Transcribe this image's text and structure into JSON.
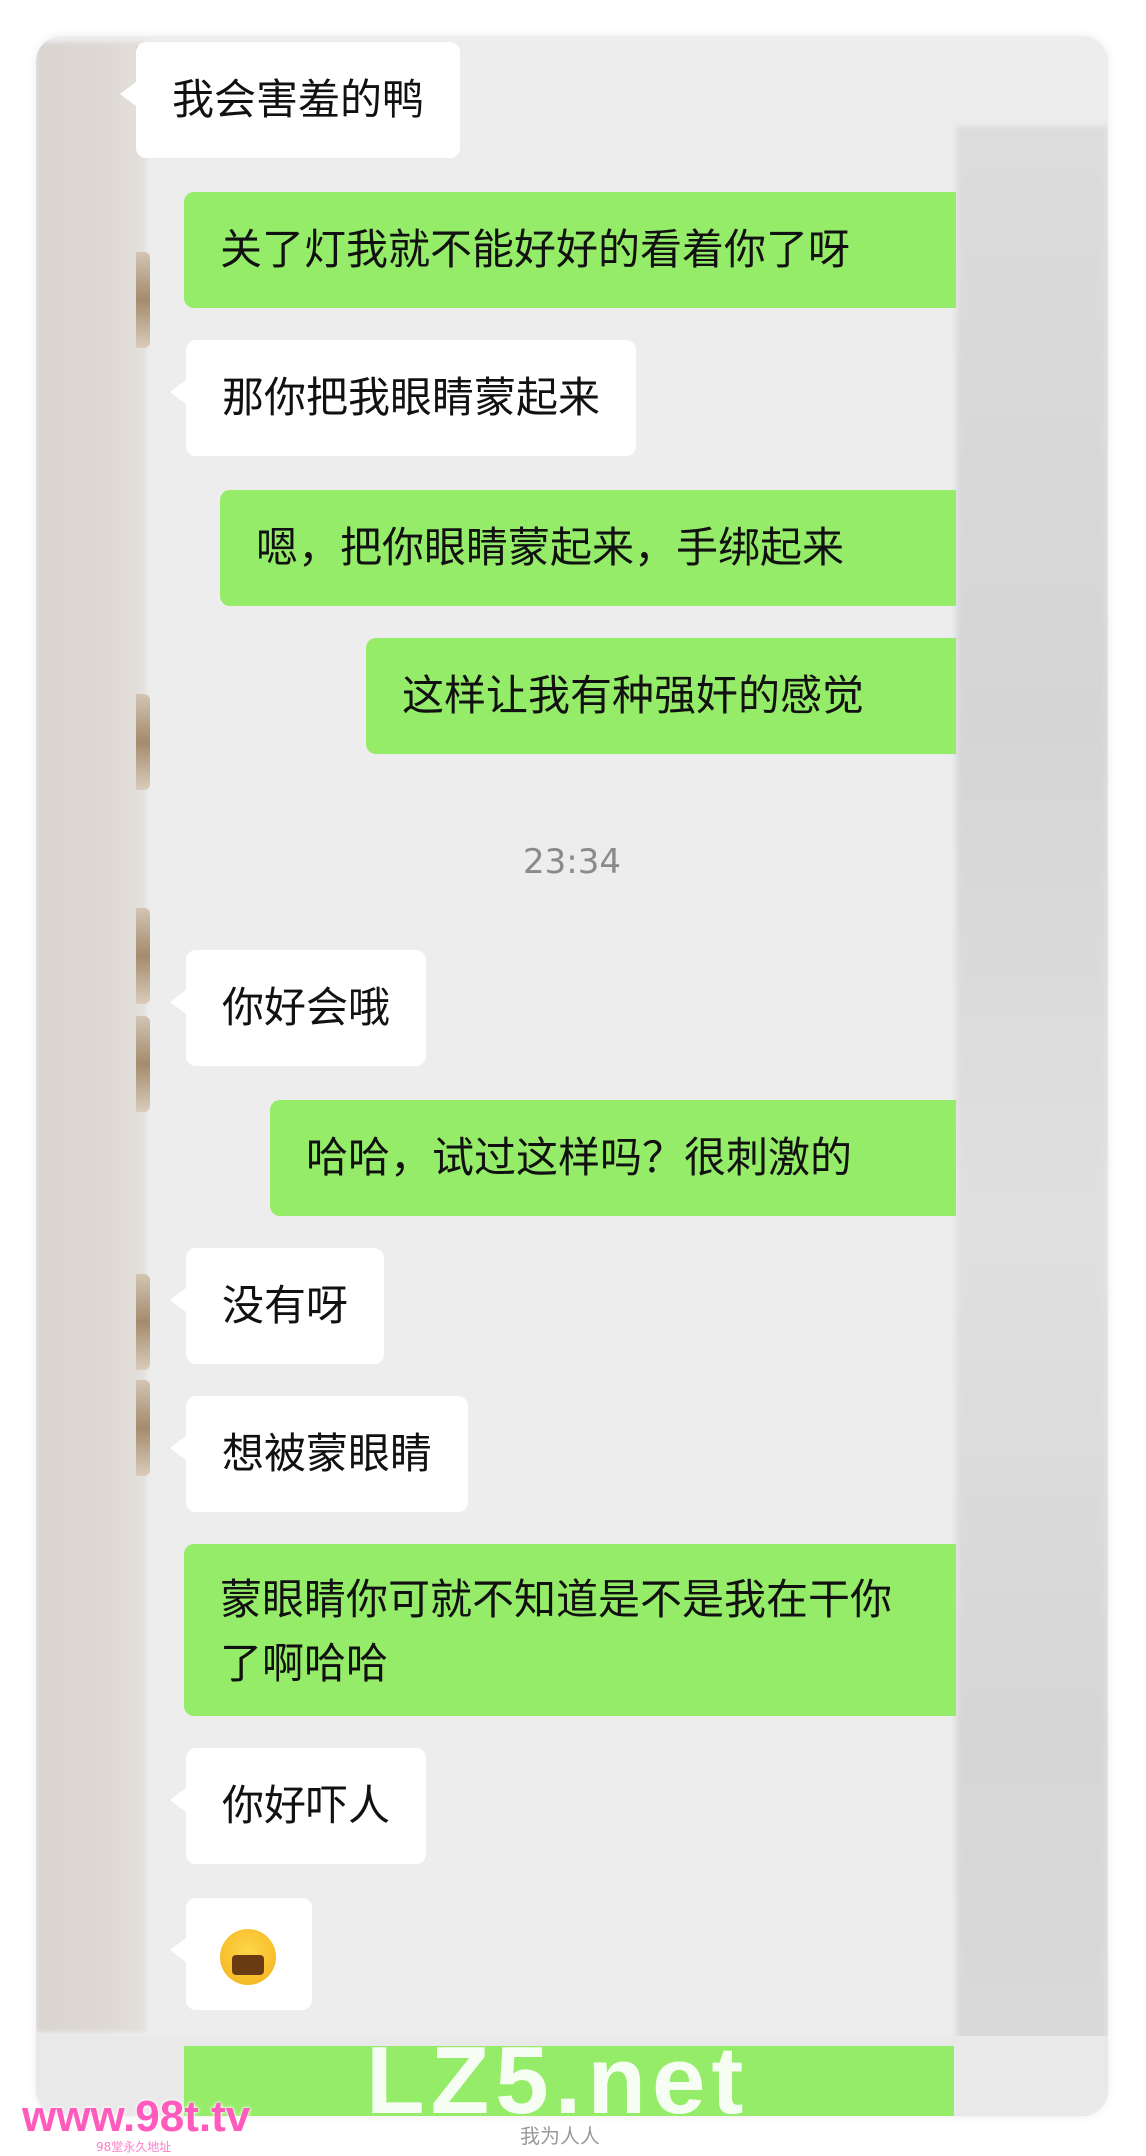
{
  "messages": [
    {
      "side": "left",
      "text": "我会害羞的鸭"
    },
    {
      "side": "right",
      "text": "关了灯我就不能好好的看着你了呀"
    },
    {
      "side": "left",
      "text": "那你把我眼睛蒙起来"
    },
    {
      "side": "right",
      "text": "嗯，把你眼睛蒙起来，手绑起来"
    },
    {
      "side": "right",
      "text": "这样让我有种强奸的感觉"
    },
    {
      "side": "left",
      "text": "你好会哦"
    },
    {
      "side": "right",
      "text": "哈哈，试过这样吗？很刺激的"
    },
    {
      "side": "left",
      "text": "没有呀"
    },
    {
      "side": "left",
      "text": "想被蒙眼睛"
    },
    {
      "side": "right",
      "text": "蒙眼睛你可就不知道是不是我在干你了啊哈哈"
    },
    {
      "side": "left",
      "text": "你好吓人"
    },
    {
      "side": "left",
      "emoji": "crying-face-emoji"
    }
  ],
  "timestamp": "23:34",
  "watermark": {
    "big": "LZ5.net",
    "small": "我为人人"
  },
  "logo": {
    "text": "www.98t.tv",
    "subtitle": "98堂永久地址"
  },
  "colors": {
    "background": "#ededed",
    "bubble_right": "#95ec69",
    "bubble_left": "#ffffff",
    "time": "#8a8a8a"
  }
}
